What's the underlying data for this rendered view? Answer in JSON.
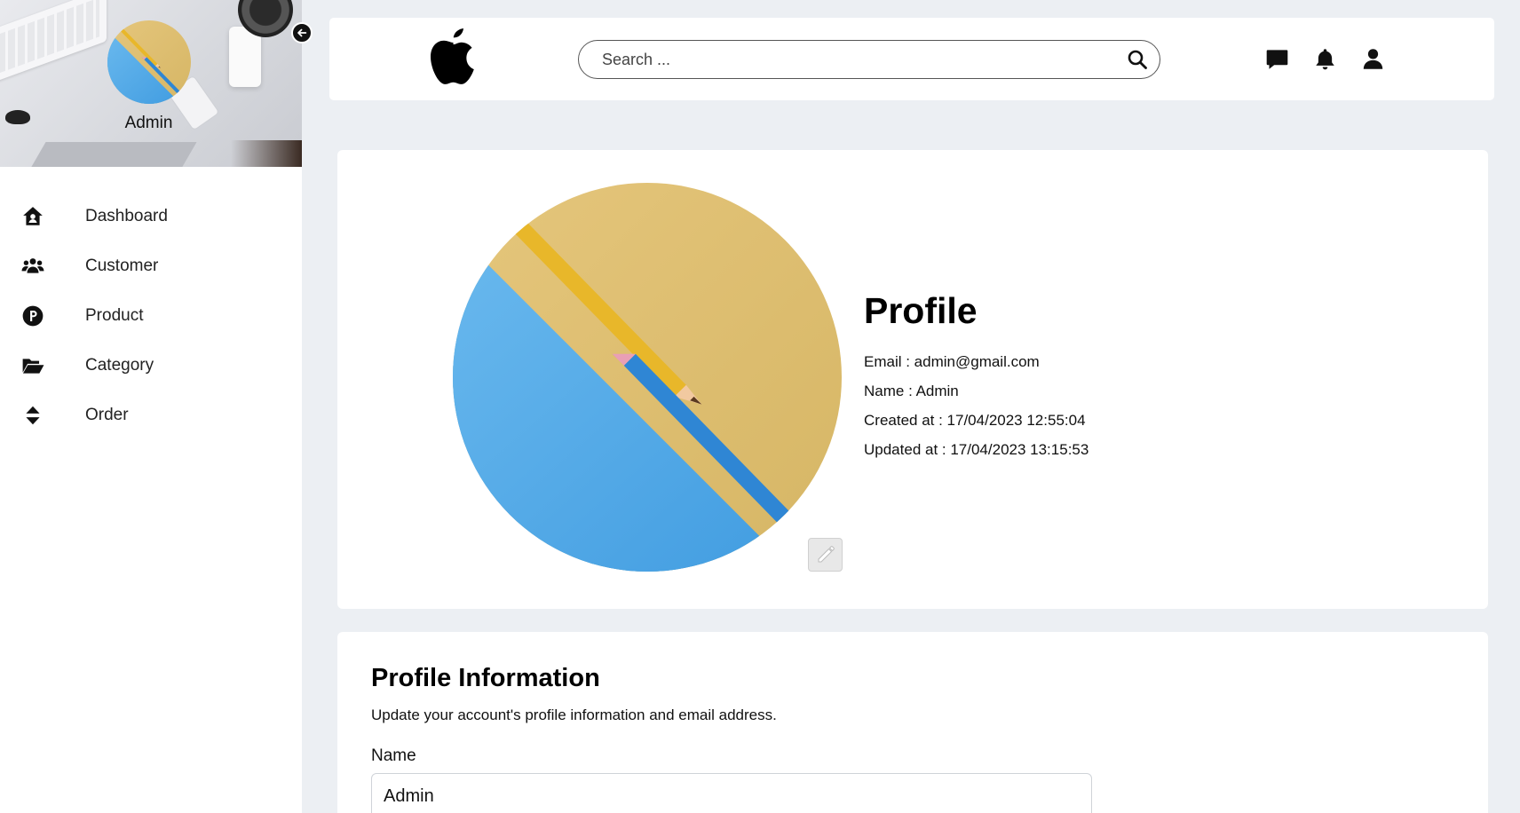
{
  "sidebar": {
    "admin_name": "Admin",
    "items": [
      {
        "label": "Dashboard",
        "icon": "home-icon"
      },
      {
        "label": "Customer",
        "icon": "users-icon"
      },
      {
        "label": "Product",
        "icon": "product-icon"
      },
      {
        "label": "Category",
        "icon": "folder-open-icon"
      },
      {
        "label": "Order",
        "icon": "sort-icon"
      }
    ]
  },
  "topbar": {
    "logo": "apple-logo",
    "search_placeholder": "Search ...",
    "icons": [
      "message-icon",
      "bell-icon",
      "user-icon"
    ]
  },
  "profile": {
    "title": "Profile",
    "email": "Email : admin@gmail.com",
    "name": "Name : Admin",
    "created_at": "Created at : 17/04/2023 12:55:04",
    "updated_at": "Updated at : 17/04/2023 13:15:53"
  },
  "profile_information": {
    "title": "Profile Information",
    "description": "Update your account's profile information and email address.",
    "name_label": "Name",
    "name_value": "Admin"
  },
  "colors": {
    "background": "#eceff3",
    "panel": "#ffffff",
    "avatar_yellow": "#e0c272",
    "avatar_blue": "#54ade8"
  }
}
